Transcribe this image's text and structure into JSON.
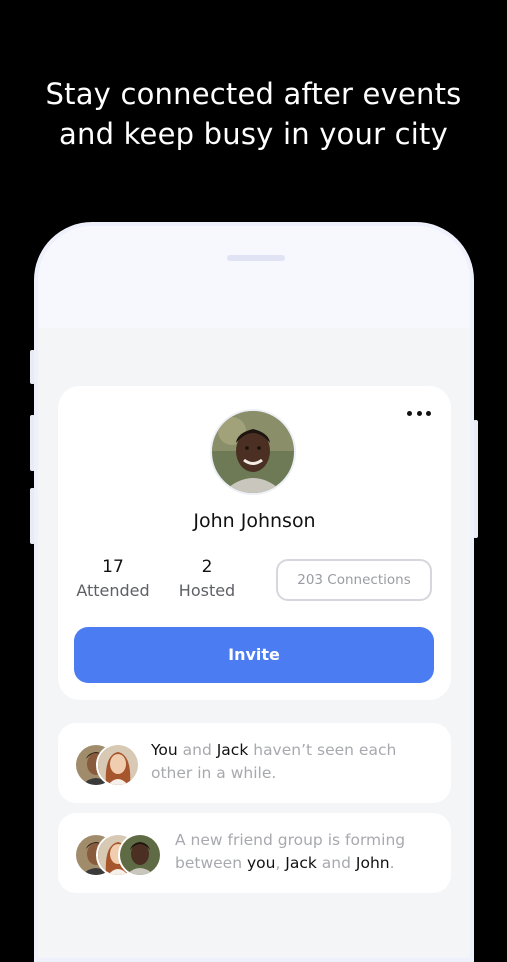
{
  "headline": {
    "line1": "Stay connected after events",
    "line2": "and keep busy in your city"
  },
  "profile": {
    "name": "John Johnson",
    "stats": [
      {
        "value": "17",
        "label": "Attended"
      },
      {
        "value": "2",
        "label": "Hosted"
      }
    ],
    "connections_label": "203 Connections",
    "invite_label": "Invite"
  },
  "activity": [
    {
      "parts": [
        "You",
        " and ",
        "Jack",
        " haven’t seen each other in a while."
      ]
    },
    {
      "parts": [
        "A new friend group is forming between ",
        "you",
        ", ",
        "Jack",
        " and ",
        "John",
        "."
      ]
    }
  ],
  "icons": {
    "more": "more-horizontal-icon"
  },
  "colors": {
    "background": "#000000",
    "accent": "#4c7cf2",
    "card": "#ffffff",
    "screen": "#f4f5f7"
  }
}
